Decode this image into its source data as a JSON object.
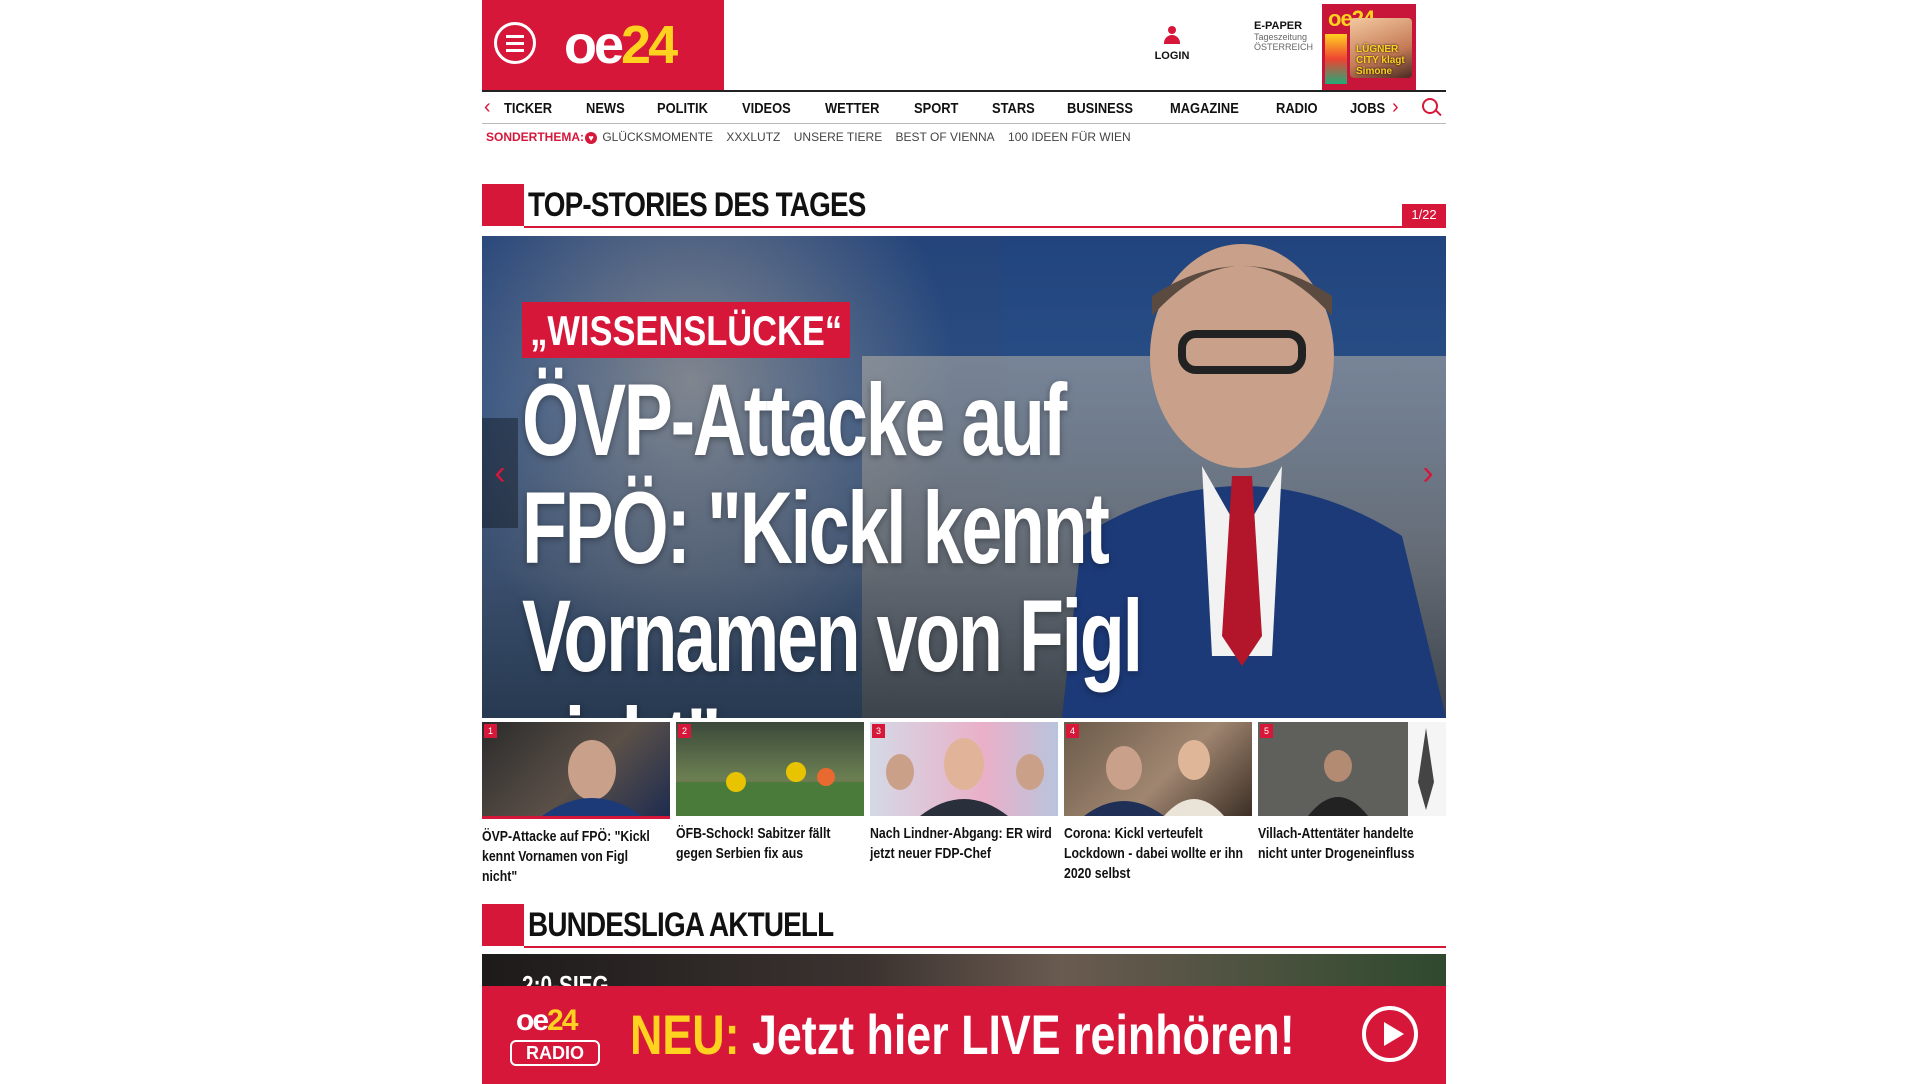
{
  "header": {
    "logo_main": "oe",
    "logo_accent": "24",
    "login_label": "LOGIN",
    "epaper": {
      "title": "E-PAPER",
      "sub1": "Tageszeitung",
      "sub2": "ÖSTERREICH",
      "cover_headline": "LÜGNER CITY klagt Simone"
    }
  },
  "nav": {
    "items": [
      "TICKER",
      "NEWS",
      "POLITIK",
      "VIDEOS",
      "WETTER",
      "SPORT",
      "STARS",
      "BUSINESS",
      "MAGAZINE",
      "RADIO",
      "JOBS"
    ],
    "prev_arrow": "‹",
    "next_arrow": "›"
  },
  "subnav": {
    "label": "SONDERTHEMA:",
    "items": [
      "GLÜCKSMOMENTE",
      "XXXLUTZ",
      "UNSERE TIERE",
      "BEST OF VIENNA",
      "100 IDEEN FÜR WIEN"
    ]
  },
  "top_stories": {
    "title": "TOP-STORIES DES TAGES",
    "counter": "1/22",
    "hero": {
      "kicker": "„WISSENSLÜCKE“",
      "headline": "ÖVP-Attacke auf FPÖ: \"Kickl kennt Vornamen von Figl nicht\""
    },
    "thumbs": [
      {
        "num": "1",
        "caption": "ÖVP-Attacke auf FPÖ: \"Kickl kennt Vornamen von Figl nicht\""
      },
      {
        "num": "2",
        "caption": "ÖFB-Schock! Sabitzer fällt gegen Serbien fix aus"
      },
      {
        "num": "3",
        "caption": "Nach Lindner-Abgang: ER wird jetzt neuer FDP-Chef"
      },
      {
        "num": "4",
        "caption": "Corona: Kickl verteufelt Lockdown - dabei wollte er ihn 2020 selbst"
      },
      {
        "num": "5",
        "caption": "Villach-Attentäter handelte nicht unter Drogeneinfluss"
      }
    ]
  },
  "bundesliga": {
    "title": "BUNDESLIGA AKTUELL",
    "preview_text": "2:0-SIEG"
  },
  "radio_banner": {
    "badge_top_a": "oe",
    "badge_top_b": "24",
    "badge_bottom": "RADIO",
    "neu": "NEU:",
    "text": "Jetzt hier LIVE reinhören!"
  },
  "colors": {
    "brand_red": "#d6173a",
    "brand_yellow": "#ffd21f"
  }
}
